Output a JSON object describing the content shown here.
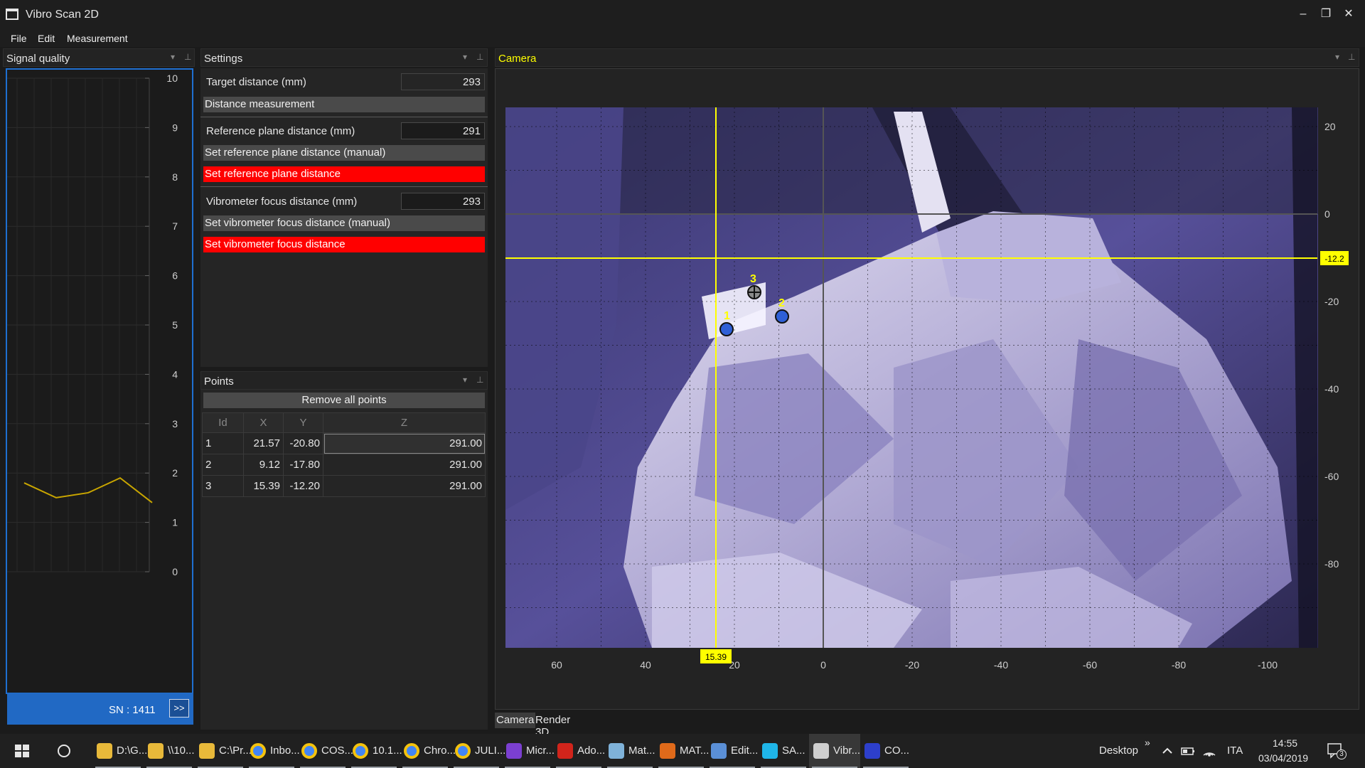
{
  "window": {
    "title": "Vibro Scan 2D",
    "icon": "app-window-icon",
    "controls": {
      "minimize": "–",
      "maximize": "❐",
      "close": "✕"
    }
  },
  "menu": [
    "File",
    "Edit",
    "Measurement"
  ],
  "panels": {
    "signal_quality": {
      "title": "Signal quality",
      "y_ticks": [
        "10",
        "9",
        "8",
        "7",
        "6",
        "5",
        "4",
        "3",
        "2",
        "1",
        "0"
      ],
      "line": [
        1.8,
        1.5,
        1.6,
        1.9,
        1.4
      ],
      "line_color": "#c9a600",
      "serial": "SN : 1411",
      "expand_button": ">>"
    },
    "settings": {
      "title": "Settings",
      "target_distance_label": "Target distance  (mm)",
      "target_distance_value": "293",
      "distance_measurement_button": "Distance measurement",
      "reference_plane_label": "Reference plane distance  (mm)",
      "reference_plane_value": "291",
      "set_reference_manual_button": "Set reference plane distance (manual)",
      "set_reference_button": "Set reference plane distance",
      "focus_label": "Vibrometer focus distance  (mm)",
      "focus_value": "293",
      "set_focus_manual_button": "Set vibrometer focus distance (manual)",
      "set_focus_button": "Set vibrometer focus distance",
      "alert_color": "#ff0000"
    },
    "points": {
      "title": "Points",
      "remove_button": "Remove all points",
      "columns": [
        "Id",
        "X",
        "Y",
        "Z"
      ],
      "rows": [
        [
          "1",
          "21.57",
          "-20.80",
          "291.00"
        ],
        [
          "2",
          "9.12",
          "-17.80",
          "291.00"
        ],
        [
          "3",
          "15.39",
          "-12.20",
          "291.00"
        ]
      ]
    },
    "camera": {
      "title": "Camera",
      "x_ticks": [
        "60",
        "40",
        "20",
        "0",
        "-20",
        "-40",
        "-60",
        "-80",
        "-100"
      ],
      "y_ticks": [
        "20",
        "0",
        "-20",
        "-40",
        "-60",
        "-80"
      ],
      "cursor_x": "15.39",
      "cursor_y": "-12.2",
      "point_labels": [
        "1",
        "2",
        "3"
      ],
      "tabs": [
        "Camera",
        "Render 3D"
      ],
      "accent": "#ffff00"
    }
  },
  "taskbar": {
    "items": [
      {
        "label": "D:\\G...",
        "icon": "folder-icon",
        "color": "#e8b93a"
      },
      {
        "label": "\\\\10...",
        "icon": "folder-icon",
        "color": "#e8b93a"
      },
      {
        "label": "C:\\Pr...",
        "icon": "folder-icon",
        "color": "#e8b93a"
      },
      {
        "label": "Inbo...",
        "icon": "chrome-icon",
        "color": "#db4437"
      },
      {
        "label": "COS...",
        "icon": "chrome-icon",
        "color": "#db4437"
      },
      {
        "label": "10.1...",
        "icon": "chrome-icon",
        "color": "#db4437"
      },
      {
        "label": "Chro...",
        "icon": "chrome-icon",
        "color": "#db4437"
      },
      {
        "label": "JULI...",
        "icon": "chrome-icon",
        "color": "#db4437"
      },
      {
        "label": "Micr...",
        "icon": "color-wheel-icon",
        "color": "#7b3fd1"
      },
      {
        "label": "Ado...",
        "icon": "acrobat-icon",
        "color": "#d1241b"
      },
      {
        "label": "Mat...",
        "icon": "cube-icon",
        "color": "#7fb2d9"
      },
      {
        "label": "MAT...",
        "icon": "matlab-icon",
        "color": "#e06a1a"
      },
      {
        "label": "Edit...",
        "icon": "notepad-icon",
        "color": "#5a8fd6"
      },
      {
        "label": "SA...",
        "icon": "s-app-icon",
        "color": "#1fb5e8"
      },
      {
        "label": "Vibr...",
        "icon": "app-window-icon",
        "color": "#cfcfcf"
      },
      {
        "label": "CO...",
        "icon": "document-app-icon",
        "color": "#2d3fcb"
      }
    ],
    "desktop": "Desktop",
    "tray_arrow": "»",
    "language": "ITA",
    "time": "14:55",
    "date": "03/04/2019",
    "notifications": "3"
  }
}
